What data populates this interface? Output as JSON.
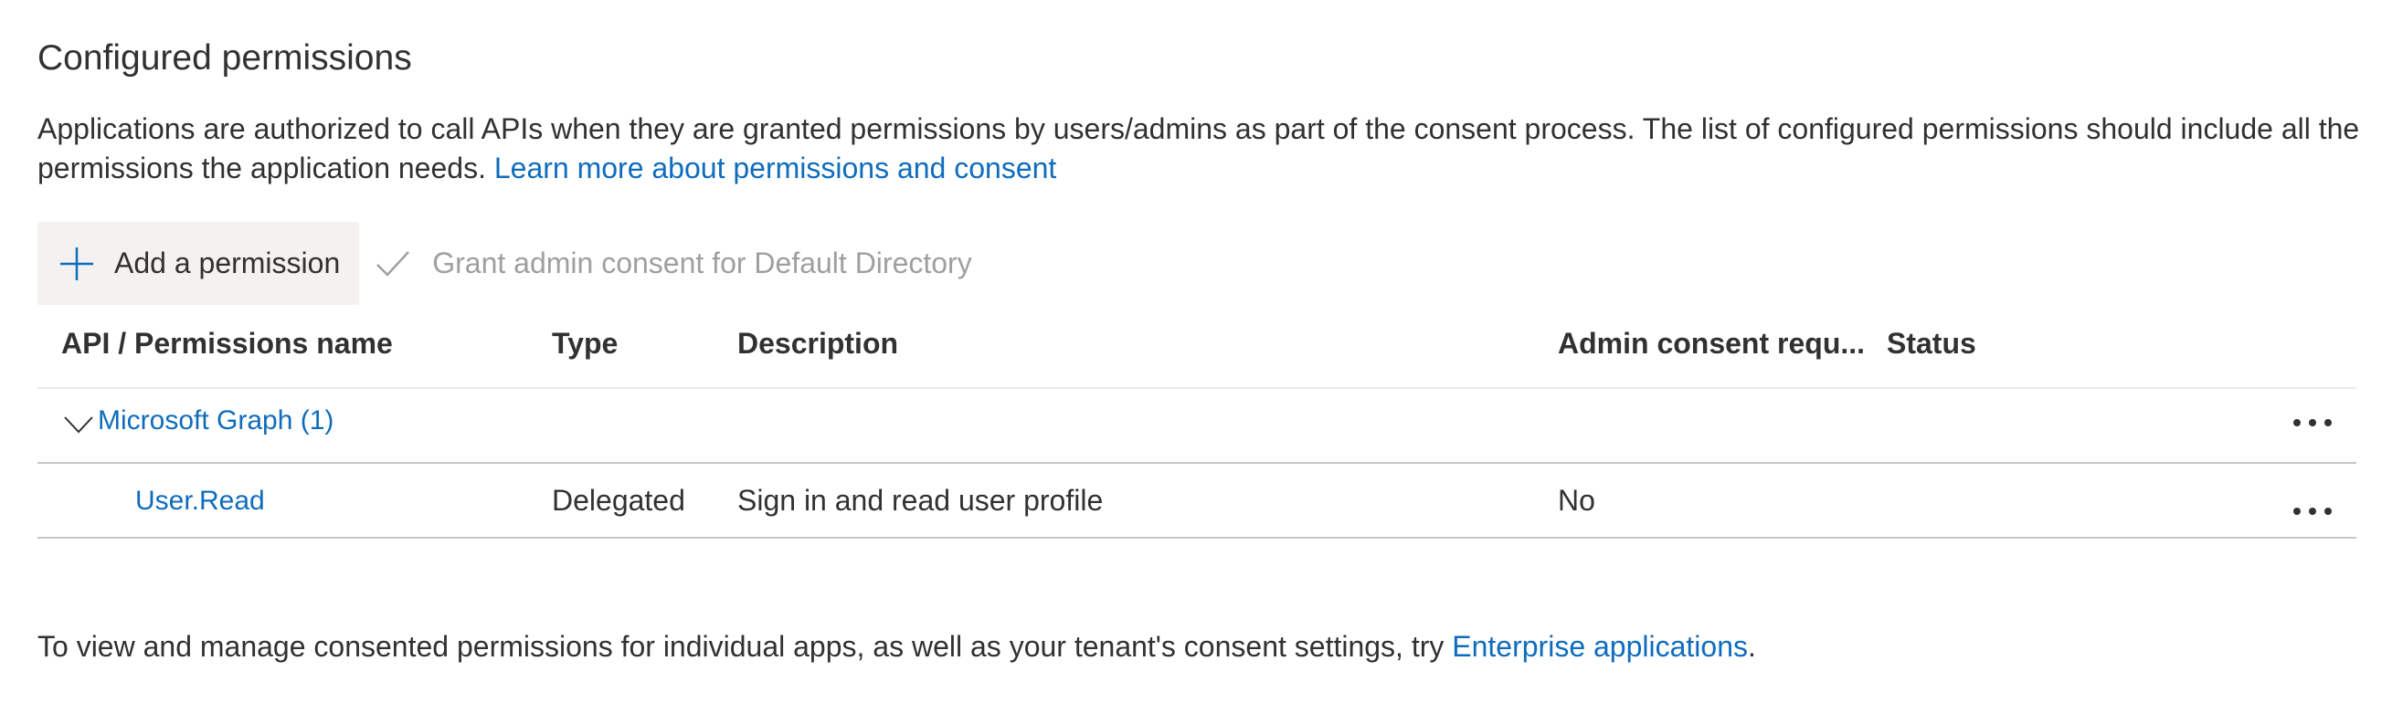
{
  "section": {
    "title": "Configured permissions",
    "intro_text": "Applications are authorized to call APIs when they are granted permissions by users/admins as part of the consent process. The list of configured permissions should include all the permissions the application needs.",
    "intro_link": "Learn more about permissions and consent"
  },
  "toolbar": {
    "add_label": "Add a permission",
    "grant_label": "Grant admin consent for Default Directory"
  },
  "table": {
    "headers": {
      "api": "API / Permissions name",
      "type": "Type",
      "description": "Description",
      "admin": "Admin consent requ...",
      "status": "Status"
    },
    "groups": [
      {
        "name": "Microsoft Graph (1)",
        "rows": [
          {
            "name": "User.Read",
            "type": "Delegated",
            "description": "Sign in and read user profile",
            "admin": "No",
            "status": ""
          }
        ]
      }
    ]
  },
  "footer": {
    "text": "To view and manage consented permissions for individual apps, as well as your tenant's consent settings, try ",
    "link": "Enterprise applications",
    "suffix": "."
  },
  "icons": {
    "add": "plus-icon",
    "grant": "checkmark-icon",
    "expand": "chevron-down-icon",
    "more": "more-icon"
  },
  "colors": {
    "link": "#0f6cbd",
    "text": "#323130",
    "disabled": "#a19f9d",
    "button_bg": "#f3f2f1"
  }
}
